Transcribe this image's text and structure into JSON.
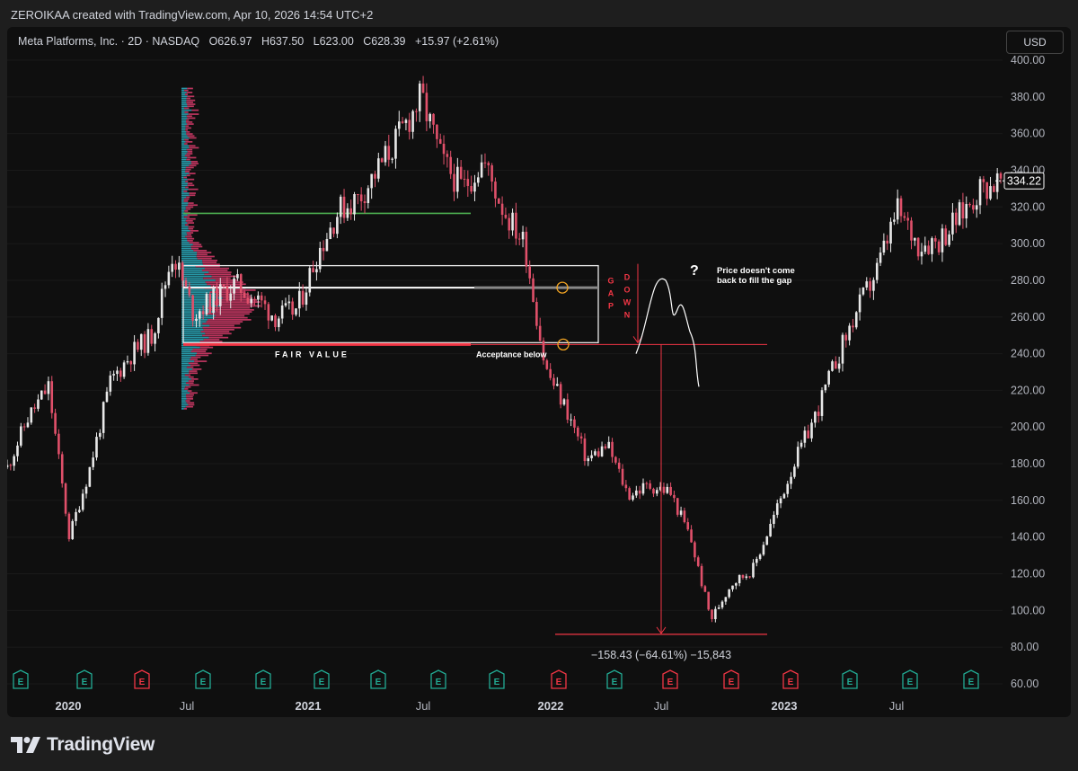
{
  "header": {
    "credit": "ZEROIKAA created with TradingView.com, Apr 10, 2026 14:54 UTC+2"
  },
  "legend": {
    "symbol": "Meta Platforms, Inc. · 2D · NASDAQ",
    "o_label": "O",
    "o_value": "626.97",
    "h_label": "H",
    "h_value": "637.50",
    "l_label": "L",
    "l_value": "623.00",
    "c_label": "C",
    "c_value": "628.39",
    "change": "+15.97 (+2.61%)"
  },
  "currency": "USD",
  "brand": {
    "name": "TradingView"
  },
  "chart_data": {
    "type": "candlestick",
    "ylim": [
      60,
      400
    ],
    "y_ticks": [
      "400.00",
      "380.00",
      "360.00",
      "340.00",
      "320.00",
      "300.00",
      "280.00",
      "260.00",
      "240.00",
      "220.00",
      "200.00",
      "180.00",
      "160.00",
      "140.00",
      "120.00",
      "100.00",
      "80.00",
      "60.00"
    ],
    "x_ticks": [
      {
        "label": "2020",
        "bold": true
      },
      {
        "label": "Jul",
        "bold": false
      },
      {
        "label": "2021",
        "bold": true
      },
      {
        "label": "Jul",
        "bold": false
      },
      {
        "label": "2022",
        "bold": true
      },
      {
        "label": "Jul",
        "bold": false
      },
      {
        "label": "2023",
        "bold": true
      },
      {
        "label": "Jul",
        "bold": false
      }
    ],
    "last_price": "334.22",
    "price_path": [
      [
        "2019-12",
        178
      ],
      [
        "2020-01",
        205
      ],
      [
        "2020-02",
        222
      ],
      [
        "2020-03",
        140
      ],
      [
        "2020-04",
        178
      ],
      [
        "2020-05",
        225
      ],
      [
        "2020-06",
        240
      ],
      [
        "2020-07",
        250
      ],
      [
        "2020-08",
        295
      ],
      [
        "2020-09",
        262
      ],
      [
        "2020-10",
        270
      ],
      [
        "2020-11",
        278
      ],
      [
        "2020-12",
        270
      ],
      [
        "2021-01",
        260
      ],
      [
        "2021-02",
        264
      ],
      [
        "2021-03",
        295
      ],
      [
        "2021-04",
        318
      ],
      [
        "2021-05",
        325
      ],
      [
        "2021-06",
        342
      ],
      [
        "2021-07",
        360
      ],
      [
        "2021-08",
        380
      ],
      [
        "2021-09",
        345
      ],
      [
        "2021-10",
        330
      ],
      [
        "2021-11",
        345
      ],
      [
        "2021-12",
        318
      ],
      [
        "2022-01",
        300
      ],
      [
        "2022-02",
        232
      ],
      [
        "2022-03",
        210
      ],
      [
        "2022-04",
        182
      ],
      [
        "2022-05",
        190
      ],
      [
        "2022-06",
        163
      ],
      [
        "2022-07",
        168
      ],
      [
        "2022-08",
        165
      ],
      [
        "2022-09",
        140
      ],
      [
        "2022-10",
        95
      ],
      [
        "2022-11",
        115
      ],
      [
        "2022-12",
        122
      ],
      [
        "2023-01",
        150
      ],
      [
        "2023-02",
        180
      ],
      [
        "2023-03",
        205
      ],
      [
        "2023-04",
        235
      ],
      [
        "2023-05",
        262
      ],
      [
        "2023-06",
        285
      ],
      [
        "2023-07",
        318
      ],
      [
        "2023-08",
        300
      ],
      [
        "2023-09",
        302
      ],
      [
        "2023-10",
        315
      ],
      [
        "2023-11",
        330
      ],
      [
        "2023-12",
        334.22
      ]
    ],
    "earnings_markers": [
      {
        "color": "teal"
      },
      {
        "color": "teal"
      },
      {
        "color": "red"
      },
      {
        "color": "teal"
      },
      {
        "color": "teal"
      },
      {
        "color": "teal"
      },
      {
        "color": "teal"
      },
      {
        "color": "teal"
      },
      {
        "color": "teal"
      },
      {
        "color": "red"
      },
      {
        "color": "teal"
      },
      {
        "color": "red"
      },
      {
        "color": "red"
      },
      {
        "color": "red"
      },
      {
        "color": "teal"
      },
      {
        "color": "teal"
      },
      {
        "color": "teal"
      }
    ],
    "annotations": {
      "fair_value": "FAIR VALUE",
      "acceptance": "Acceptance below",
      "gap_down": "GAP DOWN",
      "question": "?",
      "no_fill_line1": "Price doesn't come",
      "no_fill_line2": "back to fill the gap",
      "measure": "−158.43 (−64.61%) −15,843",
      "poc_price": 316.5,
      "value_area_high": 288,
      "value_area_low": 246,
      "mid_line": 276,
      "gap_line": 245,
      "measure_low": 87
    }
  },
  "colors": {
    "up": "#e8e8e8",
    "down": "#e0506a",
    "grid": "#1a1a1a",
    "accent_green": "#4caf50",
    "accent_red": "#f23645",
    "profile_blue": "#2aa6b8",
    "profile_pink": "#d03a68",
    "earnings_teal": "#22ab94",
    "earnings_red": "#f23645",
    "circle_orange": "#f5a623"
  }
}
